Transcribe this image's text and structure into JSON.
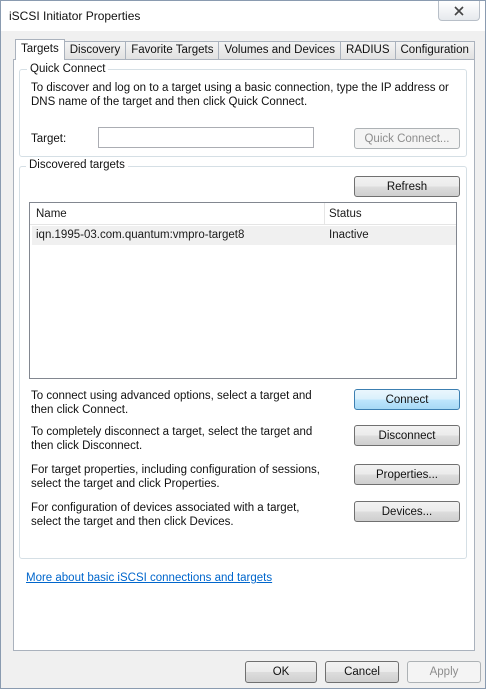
{
  "window": {
    "title": "iSCSI Initiator Properties"
  },
  "tabs": [
    {
      "label": "Targets",
      "active": true
    },
    {
      "label": "Discovery",
      "active": false
    },
    {
      "label": "Favorite Targets",
      "active": false
    },
    {
      "label": "Volumes and Devices",
      "active": false
    },
    {
      "label": "RADIUS",
      "active": false
    },
    {
      "label": "Configuration",
      "active": false
    }
  ],
  "quick_connect": {
    "legend": "Quick Connect",
    "description": "To discover and log on to a target using a basic connection, type the IP address or DNS name of the target and then click Quick Connect.",
    "target_label": "Target:",
    "target_value": "",
    "button_label": "Quick Connect..."
  },
  "discovered": {
    "legend": "Discovered targets",
    "refresh_label": "Refresh",
    "columns": {
      "name": "Name",
      "status": "Status"
    },
    "rows": [
      {
        "name": "iqn.1995-03.com.quantum:vmpro-target8",
        "status": "Inactive"
      }
    ],
    "actions": [
      {
        "text": "To connect using advanced options, select a target and then click Connect.",
        "button": "Connect"
      },
      {
        "text": "To completely disconnect a target, select the target and then click Disconnect.",
        "button": "Disconnect"
      },
      {
        "text": "For target properties, including configuration of sessions, select the target and click Properties.",
        "button": "Properties..."
      },
      {
        "text": "For configuration of devices associated with a target, select the target and then click Devices.",
        "button": "Devices..."
      }
    ]
  },
  "help_link": "More about basic iSCSI connections and targets",
  "footer": {
    "ok": "OK",
    "cancel": "Cancel",
    "apply": "Apply"
  },
  "colors": {
    "link": "#0066cc",
    "default_button_border": "#3c7fb1",
    "selected_row": "#f0f0f0"
  }
}
